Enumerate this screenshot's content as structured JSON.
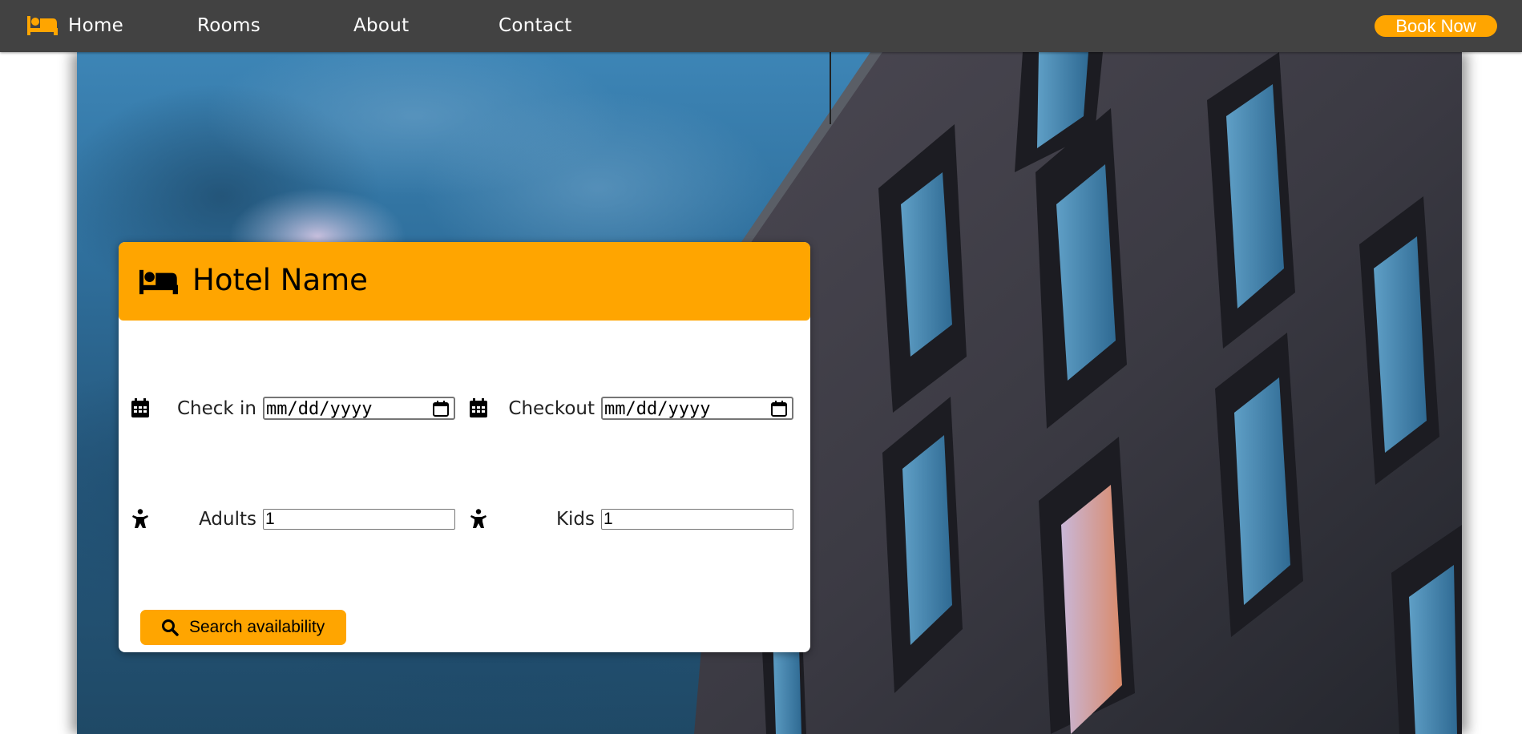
{
  "navbar": {
    "logo_icon": "bed-icon",
    "links": [
      {
        "label": "Home"
      },
      {
        "label": "Rooms"
      },
      {
        "label": "About"
      },
      {
        "label": "Contact"
      }
    ],
    "book_label": "Book Now"
  },
  "hero": {
    "background": "photo-building-at-dusk"
  },
  "card": {
    "icon": "bed-icon",
    "title": "Hotel Name",
    "checkin": {
      "icon": "calendar-icon",
      "label": "Check in",
      "placeholder": "mm/dd/yyyy"
    },
    "checkout": {
      "icon": "calendar-icon",
      "label": "Checkout",
      "placeholder": "mm/dd/yyyy"
    },
    "adults": {
      "icon": "child-icon",
      "label": "Adults",
      "value": "1"
    },
    "kids": {
      "icon": "child-icon",
      "label": "Kids",
      "value": "1"
    },
    "search": {
      "icon": "search-icon",
      "label": "Search availability"
    }
  },
  "colors": {
    "accent": "#ffa500",
    "navbar": "#424242",
    "sky": "#3d85b6",
    "building": "#3b3b45"
  }
}
